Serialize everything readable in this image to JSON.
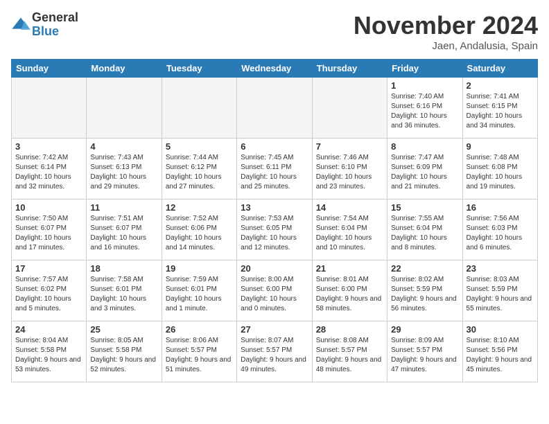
{
  "logo": {
    "general": "General",
    "blue": "Blue"
  },
  "title": "November 2024",
  "location": "Jaen, Andalusia, Spain",
  "days_of_week": [
    "Sunday",
    "Monday",
    "Tuesday",
    "Wednesday",
    "Thursday",
    "Friday",
    "Saturday"
  ],
  "weeks": [
    [
      {
        "day": "",
        "empty": true
      },
      {
        "day": "",
        "empty": true
      },
      {
        "day": "",
        "empty": true
      },
      {
        "day": "",
        "empty": true
      },
      {
        "day": "",
        "empty": true
      },
      {
        "day": "1",
        "sunrise": "7:40 AM",
        "sunset": "6:16 PM",
        "daylight": "10 hours and 36 minutes."
      },
      {
        "day": "2",
        "sunrise": "7:41 AM",
        "sunset": "6:15 PM",
        "daylight": "10 hours and 34 minutes."
      }
    ],
    [
      {
        "day": "3",
        "sunrise": "7:42 AM",
        "sunset": "6:14 PM",
        "daylight": "10 hours and 32 minutes."
      },
      {
        "day": "4",
        "sunrise": "7:43 AM",
        "sunset": "6:13 PM",
        "daylight": "10 hours and 29 minutes."
      },
      {
        "day": "5",
        "sunrise": "7:44 AM",
        "sunset": "6:12 PM",
        "daylight": "10 hours and 27 minutes."
      },
      {
        "day": "6",
        "sunrise": "7:45 AM",
        "sunset": "6:11 PM",
        "daylight": "10 hours and 25 minutes."
      },
      {
        "day": "7",
        "sunrise": "7:46 AM",
        "sunset": "6:10 PM",
        "daylight": "10 hours and 23 minutes."
      },
      {
        "day": "8",
        "sunrise": "7:47 AM",
        "sunset": "6:09 PM",
        "daylight": "10 hours and 21 minutes."
      },
      {
        "day": "9",
        "sunrise": "7:48 AM",
        "sunset": "6:08 PM",
        "daylight": "10 hours and 19 minutes."
      }
    ],
    [
      {
        "day": "10",
        "sunrise": "7:50 AM",
        "sunset": "6:07 PM",
        "daylight": "10 hours and 17 minutes."
      },
      {
        "day": "11",
        "sunrise": "7:51 AM",
        "sunset": "6:07 PM",
        "daylight": "10 hours and 16 minutes."
      },
      {
        "day": "12",
        "sunrise": "7:52 AM",
        "sunset": "6:06 PM",
        "daylight": "10 hours and 14 minutes."
      },
      {
        "day": "13",
        "sunrise": "7:53 AM",
        "sunset": "6:05 PM",
        "daylight": "10 hours and 12 minutes."
      },
      {
        "day": "14",
        "sunrise": "7:54 AM",
        "sunset": "6:04 PM",
        "daylight": "10 hours and 10 minutes."
      },
      {
        "day": "15",
        "sunrise": "7:55 AM",
        "sunset": "6:04 PM",
        "daylight": "10 hours and 8 minutes."
      },
      {
        "day": "16",
        "sunrise": "7:56 AM",
        "sunset": "6:03 PM",
        "daylight": "10 hours and 6 minutes."
      }
    ],
    [
      {
        "day": "17",
        "sunrise": "7:57 AM",
        "sunset": "6:02 PM",
        "daylight": "10 hours and 5 minutes."
      },
      {
        "day": "18",
        "sunrise": "7:58 AM",
        "sunset": "6:01 PM",
        "daylight": "10 hours and 3 minutes."
      },
      {
        "day": "19",
        "sunrise": "7:59 AM",
        "sunset": "6:01 PM",
        "daylight": "10 hours and 1 minute."
      },
      {
        "day": "20",
        "sunrise": "8:00 AM",
        "sunset": "6:00 PM",
        "daylight": "10 hours and 0 minutes."
      },
      {
        "day": "21",
        "sunrise": "8:01 AM",
        "sunset": "6:00 PM",
        "daylight": "9 hours and 58 minutes."
      },
      {
        "day": "22",
        "sunrise": "8:02 AM",
        "sunset": "5:59 PM",
        "daylight": "9 hours and 56 minutes."
      },
      {
        "day": "23",
        "sunrise": "8:03 AM",
        "sunset": "5:59 PM",
        "daylight": "9 hours and 55 minutes."
      }
    ],
    [
      {
        "day": "24",
        "sunrise": "8:04 AM",
        "sunset": "5:58 PM",
        "daylight": "9 hours and 53 minutes."
      },
      {
        "day": "25",
        "sunrise": "8:05 AM",
        "sunset": "5:58 PM",
        "daylight": "9 hours and 52 minutes."
      },
      {
        "day": "26",
        "sunrise": "8:06 AM",
        "sunset": "5:57 PM",
        "daylight": "9 hours and 51 minutes."
      },
      {
        "day": "27",
        "sunrise": "8:07 AM",
        "sunset": "5:57 PM",
        "daylight": "9 hours and 49 minutes."
      },
      {
        "day": "28",
        "sunrise": "8:08 AM",
        "sunset": "5:57 PM",
        "daylight": "9 hours and 48 minutes."
      },
      {
        "day": "29",
        "sunrise": "8:09 AM",
        "sunset": "5:57 PM",
        "daylight": "9 hours and 47 minutes."
      },
      {
        "day": "30",
        "sunrise": "8:10 AM",
        "sunset": "5:56 PM",
        "daylight": "9 hours and 45 minutes."
      }
    ]
  ]
}
